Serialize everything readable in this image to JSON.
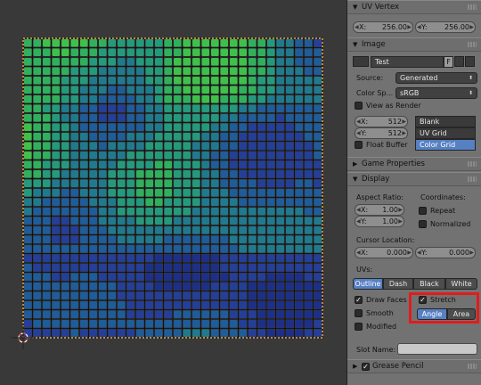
{
  "uv_vertex": {
    "title": "UV Vertex",
    "x_label": "X:",
    "x_value": "256.00",
    "y_label": "Y:",
    "y_value": "256.00"
  },
  "image": {
    "title": "Image",
    "name": "Test",
    "fake_user": "F",
    "source_label": "Source:",
    "source_value": "Generated",
    "colorspace_label": "Color Sp...",
    "colorspace_value": "sRGB",
    "view_as_render": "View as Render",
    "size_x_label": "X:",
    "size_x": "512",
    "size_y_label": "Y:",
    "size_y": "512",
    "float_buffer": "Float Buffer",
    "gen_types": [
      "Blank",
      "UV Grid",
      "Color Grid"
    ],
    "gen_selected": "Color Grid"
  },
  "game_properties": {
    "title": "Game Properties"
  },
  "display": {
    "title": "Display",
    "aspect_label": "Aspect Ratio:",
    "aspect_x_label": "X:",
    "aspect_x": "1.00",
    "aspect_y_label": "Y:",
    "aspect_y": "1.00",
    "coords_label": "Coordinates:",
    "repeat": "Repeat",
    "normalized": "Normalized",
    "cursor_label": "Cursor Location:",
    "cursor_x_label": "X:",
    "cursor_x": "0.000",
    "cursor_y_label": "Y:",
    "cursor_y": "0.000",
    "uvs_label": "UVs:",
    "uv_modes": [
      "Outline",
      "Dash",
      "Black",
      "White"
    ],
    "uv_mode_selected": "Outline",
    "draw_faces": "Draw Faces",
    "smooth": "Smooth",
    "modified": "Modified",
    "stretch": "Stretch",
    "stretch_modes": [
      "Angle",
      "Area"
    ],
    "stretch_selected": "Angle",
    "slot_name_label": "Slot Name:"
  },
  "grease_pencil": {
    "title": "Grease Pencil"
  },
  "colors": {
    "accent": "#5680c2",
    "highlight": "#e41b1b",
    "panel": "#727272",
    "edge": "#e8a33c"
  }
}
